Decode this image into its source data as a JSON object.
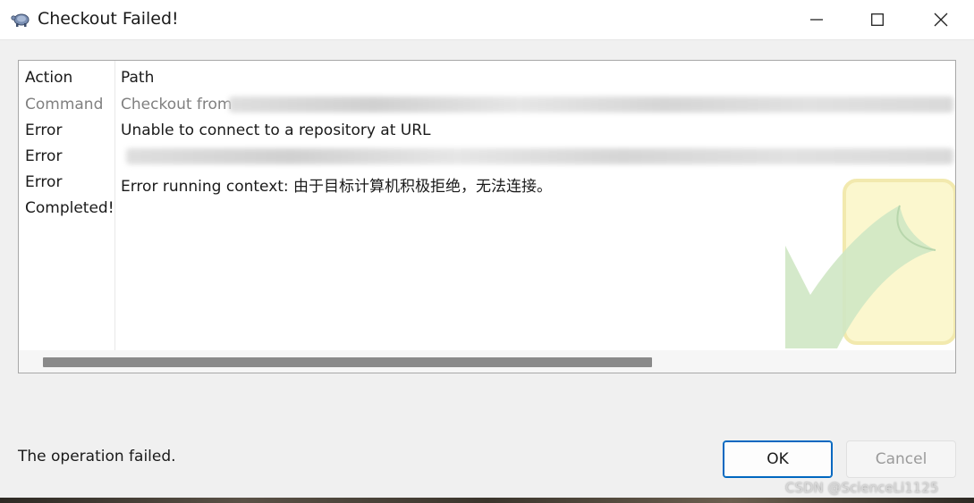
{
  "window": {
    "title": "Checkout Failed!",
    "controls": {
      "minimize": "—",
      "maximize": "☐",
      "close": "✕"
    }
  },
  "log": {
    "columns": [
      "Action",
      "Path"
    ],
    "rows": [
      {
        "action": "Command",
        "path": "Checkout from",
        "muted": true
      },
      {
        "action": "Error",
        "path": "Unable to connect to a repository at URL"
      },
      {
        "action": "Error",
        "path": ""
      },
      {
        "action": "Error",
        "path": "Error running context: 由于目标计算机积极拒绝，无法连接。"
      },
      {
        "action": "Completed!",
        "path": ""
      }
    ]
  },
  "status": {
    "message": "The operation failed."
  },
  "buttons": {
    "ok": "OK",
    "cancel": "Cancel"
  },
  "watermark": {
    "icon": "tortoisesvn-checkout-arrow-icon"
  },
  "credit": "CSDN @ScienceLi1125",
  "colors": {
    "accent": "#0067c0",
    "muted_text": "#808080"
  }
}
